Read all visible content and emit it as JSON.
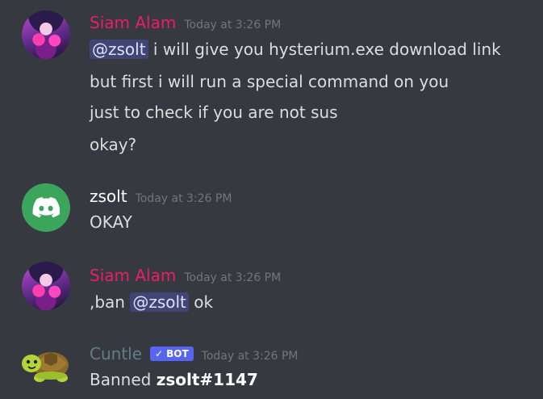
{
  "colors": {
    "background": "#36393f",
    "siam_name": "#e91e63",
    "zsolt_name": "#ffffff",
    "cuntle_name": "#607d8b",
    "mention_bg": "rgba(88,101,242,0.3)",
    "bot_tag": "#5865f2",
    "discord_green": "#3ba55c"
  },
  "messages": [
    {
      "author": "Siam Alam",
      "timestamp": "Today at 3:26 PM",
      "avatar": "anime-avatar",
      "lines": [
        {
          "mention": "@zsolt",
          "text": " i will give you hysterium.exe download link"
        },
        {
          "text": "but first i will run a special command on you"
        },
        {
          "text": "just to check if you are not sus"
        },
        {
          "text": "okay?"
        }
      ]
    },
    {
      "author": "zsolt",
      "timestamp": "Today at 3:26 PM",
      "avatar": "discord-logo-icon",
      "lines": [
        {
          "text": "OKAY"
        }
      ]
    },
    {
      "author": "Siam Alam",
      "timestamp": "Today at 3:26 PM",
      "avatar": "anime-avatar",
      "lines": [
        {
          "prefix": ",ban ",
          "mention": "@zsolt",
          "text": " ok"
        }
      ]
    },
    {
      "author": "Cuntle",
      "timestamp": "Today at 3:26 PM",
      "avatar": "turtle-icon",
      "bot_tag": {
        "check": "✓",
        "label": "BOT"
      },
      "lines": [
        {
          "prefix": "Banned ",
          "bold": "zsolt#1147"
        }
      ]
    }
  ]
}
